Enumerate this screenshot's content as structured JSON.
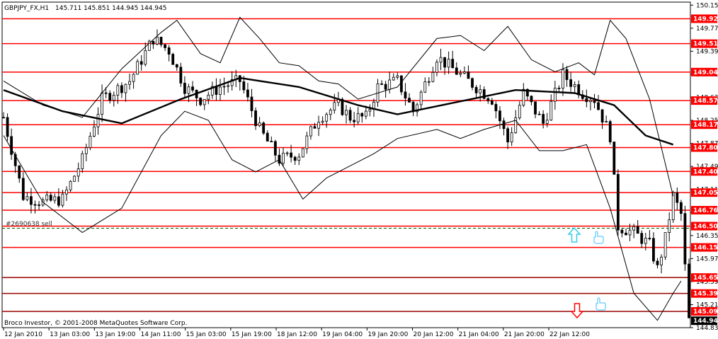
{
  "header": {
    "symbol": "GBPJPY_FX,H1",
    "quote": "145.711 145.851 144.945 144.945"
  },
  "copyright": "Broco Investor, © 2001-2008 MetaQuotes Software Corp.",
  "order_label": "#2690638 sell",
  "colors": {
    "level_line": "#ff0000",
    "level_line_dark": "#990000",
    "level_tag": "#ff0000",
    "price_tag": "#000000",
    "candles": "#000000",
    "bands": "#000000",
    "arrow_up": "#33ccee",
    "arrow_down": "#ff0000",
    "hand": "#66ccff"
  },
  "icons": {
    "arrow_up": "up-arrow-icon",
    "arrow_down": "down-arrow-icon",
    "hand": "pointing-hand-icon"
  },
  "chart_data": {
    "type": "candlestick",
    "ylim": [
      144.83,
      150.2
    ],
    "y_ticks": [
      "150.150",
      "149.770",
      "149.390",
      "149.010",
      "148.630",
      "148.250",
      "147.870",
      "147.490",
      "147.110",
      "146.730",
      "146.350",
      "145.970",
      "145.590",
      "145.210",
      "144.830"
    ],
    "levels": [
      "149.926",
      "149.515",
      "149.046",
      "148.576",
      "148.178",
      "147.801",
      "147.407",
      "147.058",
      "146.768",
      "146.505",
      "146.154",
      "145.657",
      "145.394",
      "145.099"
    ],
    "dark_levels": [
      "145.657",
      "145.394",
      "145.099"
    ],
    "current_price": "144.945",
    "order_level": 146.47,
    "x_labels": [
      "12 Jan 2010",
      "13 Jan 03:00",
      "13 Jan 19:00",
      "14 Jan 11:00",
      "15 Jan 03:00",
      "15 Jan 19:00",
      "18 Jan 12:00",
      "19 Jan 04:00",
      "19 Jan 20:00",
      "20 Jan 12:00",
      "21 Jan 04:00",
      "21 Jan 20:00",
      "22 Jan 12:00"
    ],
    "bars": 175,
    "close_path": [
      [
        0,
        148.3
      ],
      [
        5,
        147.0
      ],
      [
        10,
        146.9
      ],
      [
        15,
        146.95
      ],
      [
        20,
        147.6
      ],
      [
        25,
        148.6
      ],
      [
        32,
        148.9
      ],
      [
        38,
        149.6
      ],
      [
        42,
        149.4
      ],
      [
        46,
        148.8
      ],
      [
        50,
        148.6
      ],
      [
        55,
        148.8
      ],
      [
        60,
        148.9
      ],
      [
        65,
        148.1
      ],
      [
        70,
        147.6
      ],
      [
        75,
        147.7
      ],
      [
        80,
        148.3
      ],
      [
        85,
        148.5
      ],
      [
        88,
        148.3
      ],
      [
        92,
        148.3
      ],
      [
        95,
        148.8
      ],
      [
        100,
        148.9
      ],
      [
        104,
        148.4
      ],
      [
        110,
        149.3
      ],
      [
        116,
        149.0
      ],
      [
        120,
        148.8
      ],
      [
        124,
        148.6
      ],
      [
        128,
        147.9
      ],
      [
        132,
        148.7
      ],
      [
        137,
        148.2
      ],
      [
        142,
        149.0
      ],
      [
        147,
        148.7
      ],
      [
        150,
        148.6
      ],
      [
        154,
        148.0
      ],
      [
        156,
        146.5
      ],
      [
        160,
        146.4
      ],
      [
        164,
        146.2
      ],
      [
        166,
        145.8
      ],
      [
        168,
        146.3
      ],
      [
        170,
        147.0
      ],
      [
        172,
        146.7
      ],
      [
        174,
        144.95
      ]
    ],
    "series": [
      {
        "name": "",
        "type": "moving-average",
        "points": [
          [
            0,
            148.75
          ],
          [
            15,
            148.4
          ],
          [
            30,
            148.2
          ],
          [
            45,
            148.6
          ],
          [
            60,
            148.95
          ],
          [
            75,
            148.8
          ],
          [
            90,
            148.5
          ],
          [
            100,
            148.35
          ],
          [
            115,
            148.55
          ],
          [
            130,
            148.75
          ],
          [
            145,
            148.7
          ],
          [
            155,
            148.5
          ],
          [
            163,
            148.0
          ],
          [
            170,
            147.85
          ]
        ]
      },
      {
        "name": "",
        "type": "upper-band",
        "points": [
          [
            0,
            148.9
          ],
          [
            10,
            148.5
          ],
          [
            20,
            148.3
          ],
          [
            30,
            149.1
          ],
          [
            40,
            149.7
          ],
          [
            44,
            149.9
          ],
          [
            50,
            149.35
          ],
          [
            55,
            149.2
          ],
          [
            60,
            149.95
          ],
          [
            65,
            149.6
          ],
          [
            70,
            149.2
          ],
          [
            75,
            149.15
          ],
          [
            80,
            148.9
          ],
          [
            85,
            148.85
          ],
          [
            90,
            148.6
          ],
          [
            100,
            148.8
          ],
          [
            110,
            149.6
          ],
          [
            116,
            149.65
          ],
          [
            122,
            149.4
          ],
          [
            128,
            149.8
          ],
          [
            134,
            149.25
          ],
          [
            140,
            149.05
          ],
          [
            146,
            149.2
          ],
          [
            150,
            149.0
          ],
          [
            154,
            149.9
          ],
          [
            158,
            149.6
          ],
          [
            164,
            148.6
          ],
          [
            170,
            147.0
          ]
        ]
      },
      {
        "name": "",
        "type": "lower-band",
        "points": [
          [
            0,
            148.0
          ],
          [
            10,
            146.9
          ],
          [
            20,
            146.4
          ],
          [
            30,
            146.8
          ],
          [
            40,
            148.0
          ],
          [
            46,
            148.4
          ],
          [
            52,
            148.25
          ],
          [
            58,
            147.6
          ],
          [
            64,
            147.4
          ],
          [
            70,
            147.6
          ],
          [
            76,
            146.95
          ],
          [
            82,
            147.3
          ],
          [
            88,
            147.5
          ],
          [
            94,
            147.7
          ],
          [
            100,
            147.95
          ],
          [
            110,
            148.1
          ],
          [
            116,
            147.95
          ],
          [
            122,
            148.1
          ],
          [
            130,
            148.25
          ],
          [
            136,
            147.75
          ],
          [
            142,
            147.75
          ],
          [
            148,
            147.85
          ],
          [
            154,
            146.8
          ],
          [
            160,
            145.4
          ],
          [
            166,
            144.95
          ],
          [
            170,
            145.4
          ],
          [
            172,
            145.6
          ]
        ]
      }
    ]
  }
}
